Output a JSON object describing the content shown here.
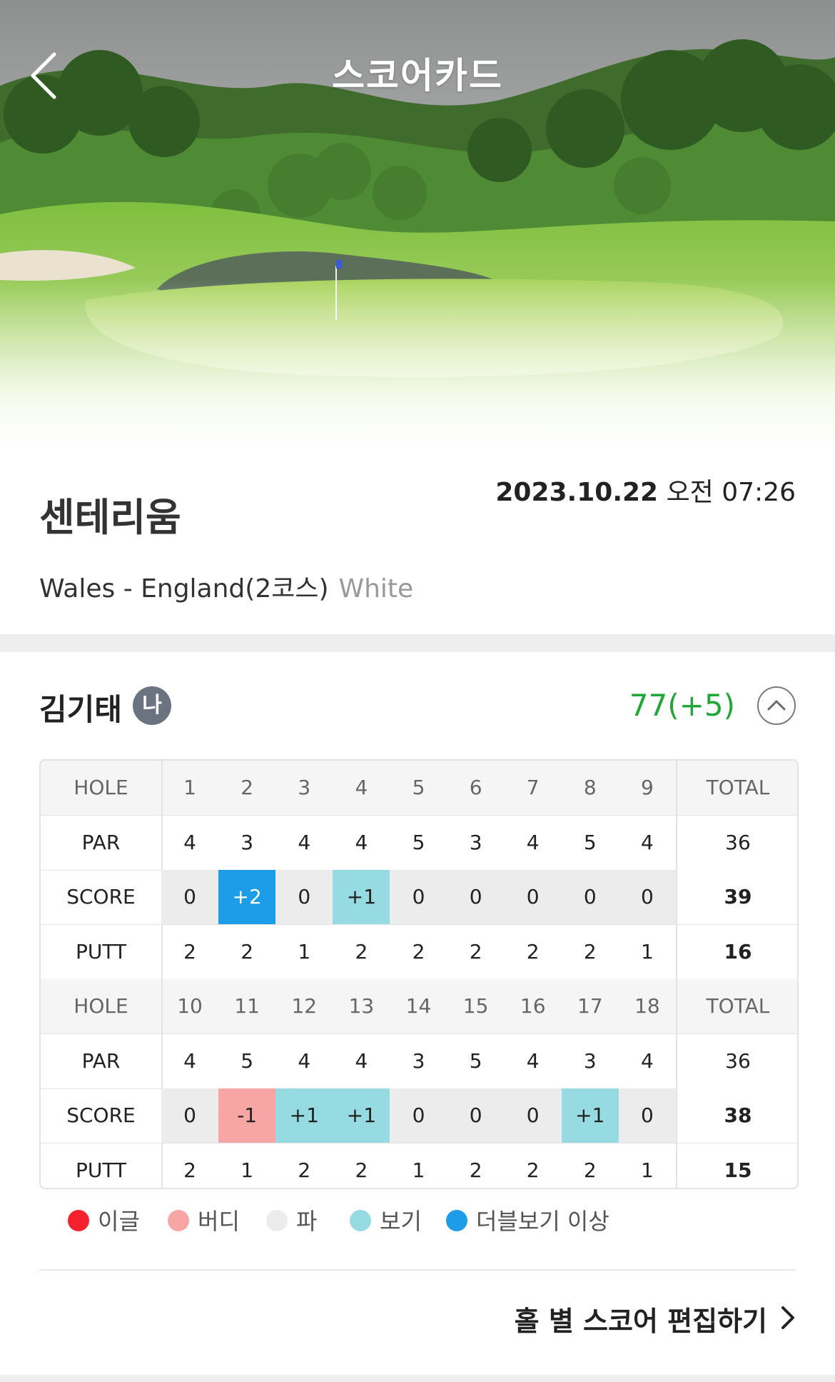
{
  "header": {
    "title": "스코어카드"
  },
  "round": {
    "course_name": "센테리움",
    "date": "2023.10.22",
    "time": "오전 07:26",
    "course_route": "Wales - England(2코스)",
    "tee": "White"
  },
  "player": {
    "name": "김기태",
    "badge": "나",
    "total": "77(+5)"
  },
  "scorecard": {
    "front": {
      "hole_label": "HOLE",
      "holes": [
        "1",
        "2",
        "3",
        "4",
        "5",
        "6",
        "7",
        "8",
        "9"
      ],
      "total_label": "TOTAL",
      "par_label": "PAR",
      "par": [
        "4",
        "3",
        "4",
        "4",
        "5",
        "3",
        "4",
        "5",
        "4"
      ],
      "par_total": "36",
      "score_label": "SCORE",
      "score": [
        "0",
        "+2",
        "0",
        "+1",
        "0",
        "0",
        "0",
        "0",
        "0"
      ],
      "score_total": "39",
      "putt_label": "PUTT",
      "putt": [
        "2",
        "2",
        "1",
        "2",
        "2",
        "2",
        "2",
        "2",
        "1"
      ],
      "putt_total": "16"
    },
    "back": {
      "hole_label": "HOLE",
      "holes": [
        "10",
        "11",
        "12",
        "13",
        "14",
        "15",
        "16",
        "17",
        "18"
      ],
      "total_label": "TOTAL",
      "par_label": "PAR",
      "par": [
        "4",
        "5",
        "4",
        "4",
        "3",
        "5",
        "4",
        "3",
        "4"
      ],
      "par_total": "36",
      "score_label": "SCORE",
      "score": [
        "0",
        "-1",
        "+1",
        "+1",
        "0",
        "0",
        "0",
        "+1",
        "0"
      ],
      "score_total": "38",
      "putt_label": "PUTT",
      "putt": [
        "2",
        "1",
        "2",
        "2",
        "1",
        "2",
        "2",
        "2",
        "1"
      ],
      "putt_total": "15"
    }
  },
  "legend": [
    {
      "label": "이글",
      "color": "#f5222d"
    },
    {
      "label": "버디",
      "color": "#f8a5a5"
    },
    {
      "label": "파",
      "color": "#ececec"
    },
    {
      "label": "보기",
      "color": "#97dbe2"
    },
    {
      "label": "더블보기 이상",
      "color": "#1d9de8"
    }
  ],
  "score_colors": {
    "double_bogey_plus": "#1d9de8",
    "bogey": "#97dbe2",
    "par": "#ececec",
    "birdie": "#f8a5a5",
    "eagle": "#f5222d"
  },
  "footer": {
    "edit_label": "홀 별 스코어 편집하기"
  },
  "colors": {
    "accent_green": "#21a637"
  }
}
